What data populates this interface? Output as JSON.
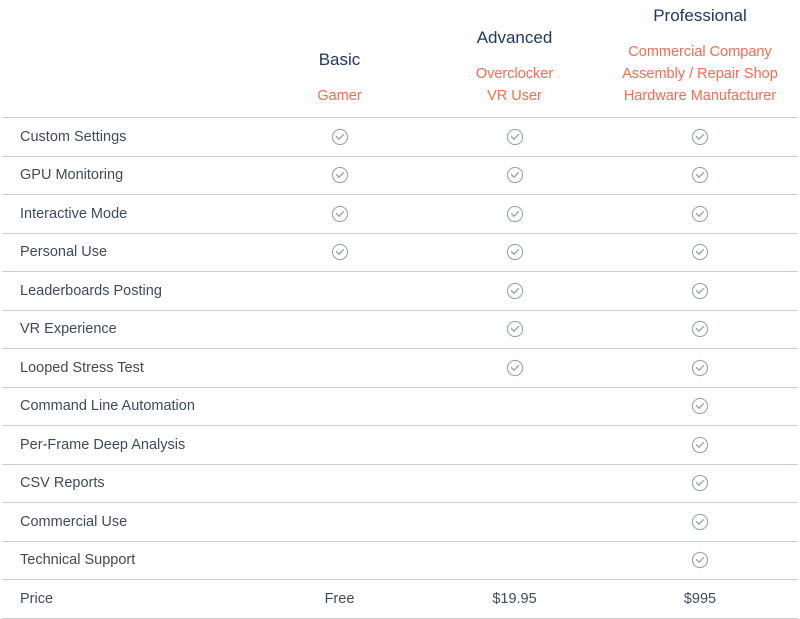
{
  "table": {
    "feature_column_header": "",
    "plans": [
      {
        "name": "Basic",
        "audience": [
          "Gamer"
        ],
        "price": "Free"
      },
      {
        "name": "Advanced",
        "audience": [
          "Overclocker",
          "VR User"
        ],
        "price": "$19.95"
      },
      {
        "name": "Professional",
        "audience": [
          "Commercial Company",
          "Assembly / Repair Shop",
          "Hardware Manufacturer"
        ],
        "price": "$995"
      }
    ],
    "price_row_label": "Price",
    "features": [
      {
        "label": "Custom Settings",
        "basic": true,
        "advanced": true,
        "professional": true
      },
      {
        "label": "GPU Monitoring",
        "basic": true,
        "advanced": true,
        "professional": true
      },
      {
        "label": "Interactive Mode",
        "basic": true,
        "advanced": true,
        "professional": true
      },
      {
        "label": "Personal Use",
        "basic": true,
        "advanced": true,
        "professional": true
      },
      {
        "label": "Leaderboards Posting",
        "basic": false,
        "advanced": true,
        "professional": true
      },
      {
        "label": "VR Experience",
        "basic": false,
        "advanced": true,
        "professional": true
      },
      {
        "label": "Looped Stress Test",
        "basic": false,
        "advanced": true,
        "professional": true
      },
      {
        "label": "Command Line Automation",
        "basic": false,
        "advanced": false,
        "professional": true
      },
      {
        "label": "Per-Frame Deep Analysis",
        "basic": false,
        "advanced": false,
        "professional": true
      },
      {
        "label": "CSV Reports",
        "basic": false,
        "advanced": false,
        "professional": true
      },
      {
        "label": "Commercial Use",
        "basic": false,
        "advanced": false,
        "professional": true
      },
      {
        "label": "Technical Support",
        "basic": false,
        "advanced": false,
        "professional": true
      }
    ]
  },
  "icons": {
    "check": "check-circle-icon"
  },
  "colors": {
    "plan_name": "#1f3864",
    "audience": "#f96a50",
    "feature_text": "#3f4a5a",
    "rule": "#c9cfd6",
    "check": "#9aa4b0",
    "background": "#ffffff"
  }
}
